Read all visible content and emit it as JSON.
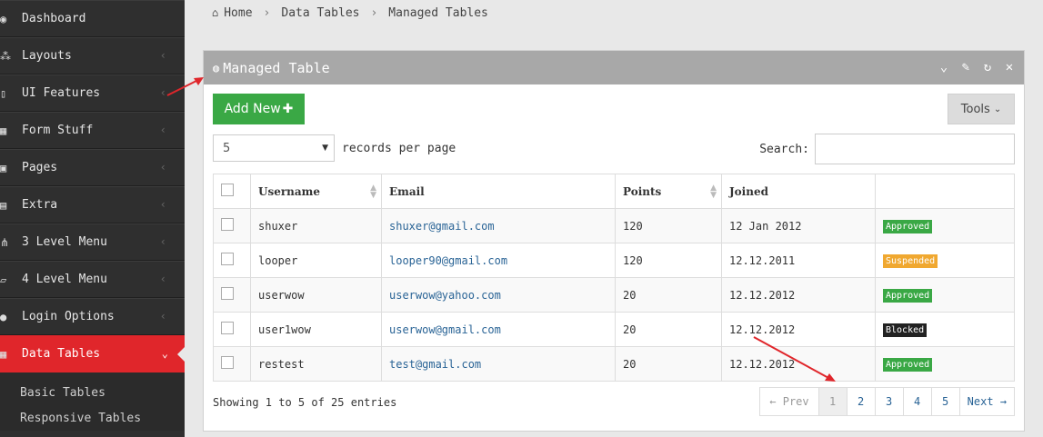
{
  "sidebar": {
    "items": [
      {
        "label": "Dashboard",
        "icon": "dashboard-icon",
        "glyph": "◉",
        "chevron": ""
      },
      {
        "label": "Layouts",
        "icon": "sitemap-icon",
        "glyph": "⁂",
        "chevron": "‹"
      },
      {
        "label": "UI Features",
        "icon": "file-icon",
        "glyph": "▯",
        "chevron": "‹"
      },
      {
        "label": "Form Stuff",
        "icon": "table-icon",
        "glyph": "▦",
        "chevron": "‹"
      },
      {
        "label": "Pages",
        "icon": "briefcase-icon",
        "glyph": "▣",
        "chevron": "‹"
      },
      {
        "label": "Extra",
        "icon": "inbox-icon",
        "glyph": "▤",
        "chevron": "‹"
      },
      {
        "label": "3 Level Menu",
        "icon": "sitemap-icon",
        "glyph": "⋔",
        "chevron": "‹"
      },
      {
        "label": "4 Level Menu",
        "icon": "folder-open-icon",
        "glyph": "▱",
        "chevron": "‹"
      },
      {
        "label": "Login Options",
        "icon": "user-icon",
        "glyph": "●",
        "chevron": "‹"
      },
      {
        "label": "Data Tables",
        "icon": "th-icon",
        "glyph": "▦",
        "chevron": "⌄"
      }
    ],
    "sub_items": [
      "Basic Tables",
      "Responsive Tables"
    ]
  },
  "breadcrumb": {
    "home": "Home",
    "items": [
      "Data Tables",
      "Managed Tables"
    ]
  },
  "panel": {
    "title": "Managed Table"
  },
  "toolbar": {
    "add_label": "Add New",
    "tools_label": "Tools"
  },
  "per_page": {
    "value": "5",
    "label": "records per page"
  },
  "search": {
    "label": "Search:",
    "value": ""
  },
  "table": {
    "headers": [
      "Username",
      "Email",
      "Points",
      "Joined"
    ],
    "rows": [
      {
        "username": "shuxer",
        "email": "shuxer@gmail.com",
        "points": "120",
        "joined": "12 Jan 2012",
        "status": "Approved",
        "status_color": "#3aa845"
      },
      {
        "username": "looper",
        "email": "looper90@gmail.com",
        "points": "120",
        "joined": "12.12.2011",
        "status": "Suspended",
        "status_color": "#f0a830"
      },
      {
        "username": "userwow",
        "email": "userwow@yahoo.com",
        "points": "20",
        "joined": "12.12.2012",
        "status": "Approved",
        "status_color": "#3aa845"
      },
      {
        "username": "user1wow",
        "email": "userwow@gmail.com",
        "points": "20",
        "joined": "12.12.2012",
        "status": "Blocked",
        "status_color": "#222222"
      },
      {
        "username": "restest",
        "email": "test@gmail.com",
        "points": "20",
        "joined": "12.12.2012",
        "status": "Approved",
        "status_color": "#3aa845"
      }
    ]
  },
  "footer": {
    "showing": "Showing 1 to 5 of 25 entries"
  },
  "pagination": {
    "prev": "← Prev",
    "pages": [
      "1",
      "2",
      "3",
      "4",
      "5"
    ],
    "next": "Next →",
    "current": "1"
  },
  "colors": {
    "accent": "#e0262b",
    "success": "#3aa845",
    "warning": "#f0a830"
  }
}
